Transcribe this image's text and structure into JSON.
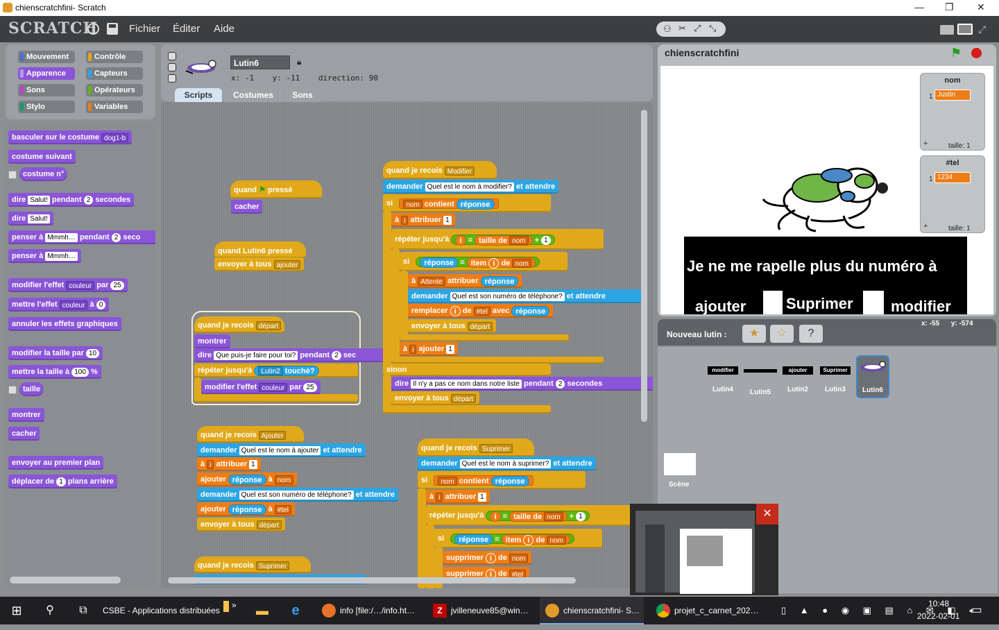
{
  "window": {
    "title": "chienscratchfini- Scratch",
    "minimize": "—",
    "maximize": "❐",
    "close": "✕"
  },
  "menubar": {
    "logo": "SCRATCH",
    "items": [
      "Fichier",
      "Éditer",
      "Aide"
    ]
  },
  "categories": {
    "left": [
      {
        "label": "Mouvement",
        "color": "#4a6cd4"
      },
      {
        "label": "Apparence",
        "color": "#8a55d7"
      },
      {
        "label": "Sons",
        "color": "#bb42c3"
      },
      {
        "label": "Stylo",
        "color": "#0e9a6c"
      }
    ],
    "right": [
      {
        "label": "Contrôle",
        "color": "#e1a91a"
      },
      {
        "label": "Capteurs",
        "color": "#2ca5e2"
      },
      {
        "label": "Opérateurs",
        "color": "#5cb712"
      },
      {
        "label": "Variables",
        "color": "#ee7d16"
      }
    ]
  },
  "palette": {
    "switch_costume": "basculer sur le costume",
    "switch_costume_val": "dog1-b",
    "next_costume": "costume suivant",
    "costume_no": "costume n°",
    "say_for": "dire",
    "say_text": "Salut!",
    "say_for_pendant": "pendant",
    "say_for_num": "2",
    "say_for_secondes": "secondes",
    "say": "dire",
    "say2_text": "Salut!",
    "think_for": "penser à",
    "think_text": "Mmmh…",
    "think_pendant": "pendant",
    "think_num": "2",
    "think_seco": "seco",
    "think": "penser à",
    "think2_text": "Mmmh…",
    "change_effect": "modifier l'effet",
    "change_effect_val": "couleur",
    "change_effect_par": "par",
    "change_effect_num": "25",
    "set_effect": "mettre l'effet",
    "set_effect_val": "couleur",
    "set_effect_a": "à",
    "set_effect_num": "0",
    "clear_effects": "annuler les effets graphiques",
    "change_size": "modifier la taille par",
    "change_size_num": "10",
    "set_size": "mettre la taille à",
    "set_size_num": "100",
    "set_size_pct": "%",
    "size": "taille",
    "show": "montrer",
    "hide": "cacher",
    "front": "envoyer au premier plan",
    "back": "déplacer de",
    "back_num": "1",
    "back_tail": "plans arrière"
  },
  "sprite_info": {
    "name": "Lutin6",
    "x_label": "x:",
    "x": "-1",
    "y_label": "y:",
    "y": "-11",
    "direction_label": "direction:",
    "direction": "90"
  },
  "tabs": [
    "Scripts",
    "Costumes",
    "Sons"
  ],
  "scripts": {
    "s1": {
      "hat": "quand",
      "hat2": "pressé",
      "b1": "cacher"
    },
    "s2": {
      "hat": "quand Lutin6 pressé",
      "b1": "envoyer à tous",
      "b1v": "ajouter"
    },
    "s3": {
      "hat": "quand je recois",
      "hatv": "départ",
      "b1": "montrer",
      "b2": "dire",
      "b2t": "Que puis-je faire pour toi?",
      "b2p": "pendant",
      "b2n": "2",
      "b2s": "sec",
      "b3": "répéter jusqu'à",
      "b3s": "Lutin2",
      "b3t": "touché?",
      "b4": "modifier l'effet",
      "b4v": "couleur",
      "b4p": "par",
      "b4n": "25"
    },
    "s4": {
      "hat": "quand je recois",
      "hatv": "Ajouter",
      "b1": "demander",
      "b1t": "Quel est le nom à ajouter",
      "b1e": "et attendre",
      "b2": "à",
      "b2v": "i",
      "b2a": "attribuer",
      "b2n": "1",
      "b3": "ajouter",
      "b3r": "réponse",
      "b3a": "à",
      "b3v": "nom",
      "b4": "demander",
      "b4t": "Quel est son numéro de téléphone?",
      "b4e": "et attendre",
      "b5": "ajouter",
      "b5r": "réponse",
      "b5a": "à",
      "b5v": "#tel",
      "b6": "envoyer à tous",
      "b6v": "départ"
    },
    "s5": {
      "hat": "quand je recois",
      "hatv": "Suprimer"
    },
    "s6": {
      "hat": "quand je recois",
      "hatv": "Modifier",
      "b1": "demander",
      "b1t": "Quel est le nom à modifier?",
      "b1e": "et attendre",
      "si": "si",
      "c1v": "nom",
      "c1": "contient",
      "c1r": "réponse",
      "b2": "à",
      "b2v": "i",
      "b2a": "attribuer",
      "b2n": "1",
      "b3": "répéter jusqu'à",
      "b3i": "i",
      "b3eq": "=",
      "b3t": "taille de",
      "b3v": "nom",
      "b3p": "+",
      "b3n": "1",
      "si2": "si",
      "c2r": "réponse",
      "c2eq": "=",
      "c2i": "item",
      "c2ii": "i",
      "c2d": "de",
      "c2v": "nom",
      "b4": "à",
      "b4v": "Attente",
      "b4a": "attribuer",
      "b4r": "réponse",
      "b5": "demander",
      "b5t": "Quel est son numéro de téléphone?",
      "b5e": "et attendre",
      "b6": "remplacer",
      "b6i": "i",
      "b6d": "de",
      "b6v": "#tel",
      "b6a": "avec",
      "b6r": "réponse",
      "b7": "envoyer à tous",
      "b7v": "départ",
      "b8": "à",
      "b8v": "i",
      "b8a": "ajouter",
      "b8n": "1",
      "sinon": "sinon",
      "b9": "dire",
      "b9t": "Il n'y a pas ce nom dans notre liste",
      "b9p": "pendant",
      "b9n": "2",
      "b9s": "secondes",
      "b10": "envoyer à tous",
      "b10v": "départ"
    },
    "s7": {
      "hat": "quand je recois",
      "hatv": "Suprimer",
      "b1": "demander",
      "b1t": "Quel est le nom à suprimer?",
      "b1e": "et attendre",
      "si": "si",
      "c1v": "nom",
      "c1": "contient",
      "c1r": "réponse",
      "b2": "à",
      "b2v": "i",
      "b2a": "attribuer",
      "b2n": "1",
      "b3": "répéter jusqu'à",
      "b3i": "i",
      "b3eq": "=",
      "b3t": "taille de",
      "b3v": "nom",
      "b3p": "+",
      "b3n": "1",
      "si2": "si",
      "c2r": "réponse",
      "c2eq": "=",
      "c2i": "item",
      "c2ii": "i",
      "c2d": "de",
      "c2v": "nom",
      "b4": "supprimer",
      "b4i": "i",
      "b4d": "de",
      "b4v": "nom",
      "b5": "supprimer",
      "b5i": "i",
      "b5d": "de",
      "b5v": "#tel"
    }
  },
  "stage": {
    "title": "chienscratchfini",
    "list1": {
      "name": "nom",
      "index": "1",
      "value": "Justin",
      "plus": "+",
      "size": "taille: 1"
    },
    "list2": {
      "name": "#tel",
      "index": "1",
      "value": "1234",
      "plus": "+",
      "size": "taille: 1"
    },
    "speech": "Je ne me rapelle plus du numéro à",
    "buttons": [
      "ajouter",
      "Suprimer",
      "modifier"
    ],
    "coords_x_label": "x:",
    "coords_x": "-55",
    "coords_y_label": "y:",
    "coords_y": "-574"
  },
  "new_sprite_label": "Nouveau lutin :",
  "sprites": [
    {
      "name": "Lutin4",
      "thumb": "modifier"
    },
    {
      "name": "Lutin5",
      "thumb": ""
    },
    {
      "name": "Lutin2",
      "thumb": "ajouter"
    },
    {
      "name": "Lutin3",
      "thumb": "Suprimer"
    },
    {
      "name": "Lutin6",
      "thumb": ""
    }
  ],
  "scene_label": "Scène",
  "taskbar": {
    "items": [
      "CSBE - Applications distribuées",
      "info [file:/…/info.ht…",
      "jvilleneuve85@win…",
      "chienscratchfini- S…",
      "projet_c_carnet_202…"
    ],
    "time": "10:48",
    "date": "2022-02-01",
    "more": "»"
  }
}
